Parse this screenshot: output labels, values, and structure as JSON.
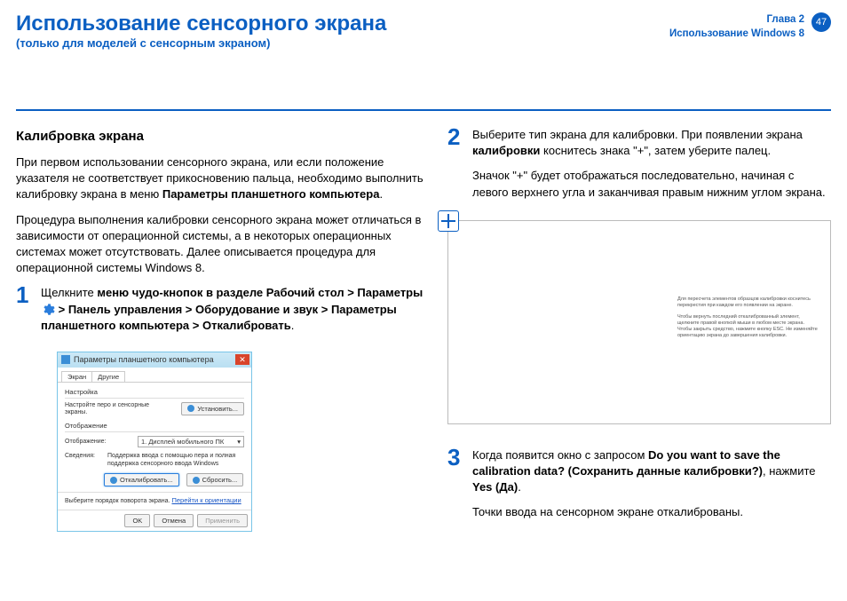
{
  "header": {
    "title": "Использование сенсорного экрана",
    "subtitle": "(только для моделей с сенсорным экраном)",
    "chapter": "Глава 2",
    "chapter_sub": "Использование Windows 8",
    "page_num": "47"
  },
  "left": {
    "section_title": "Калибровка экрана",
    "p1a": "При первом использовании сенсорного экрана, или если положение указателя не соответствует прикосновению пальца, необходимо выполнить калибровку экрана в меню ",
    "p1b": "Параметры планшетного компьютера",
    "p1c": ".",
    "p2": "Процедура выполнения калибровки сенсорного экрана может отличаться в зависимости от операционной системы, а в некоторых операционных системах может отсутствовать. Далее описывается процедура для операционной системы Windows 8.",
    "step1": {
      "num": "1",
      "t1": "Щелкните ",
      "t2": "меню чудо-кнопок в разделе Рабочий стол > Параметры ",
      "t3": " > Панель управления > Оборудование и звук > Параметры планшетного компьютера > Откалибровать",
      "t4": "."
    }
  },
  "dialog": {
    "title": "Параметры планшетного компьютера",
    "tab1": "Экран",
    "tab2": "Другие",
    "group1_label": "Настройка",
    "group1_text": "Настройте перо и сенсорные экраны.",
    "btn_set": "Установить...",
    "group2_label": "Отображение",
    "display_label": "Отображение:",
    "display_value": "1. Дисплей мобильного ПК",
    "detail_label": "Сведения:",
    "detail_text": "Поддержка ввода с помощью пера и полная поддержка сенсорного ввода Windows",
    "btn_calibrate": "Откалибровать...",
    "btn_reset": "Сбросить...",
    "footer_text": "Выберите порядок поворота экрана.",
    "footer_link": "Перейти к ориентации",
    "btn_ok": "OK",
    "btn_cancel": "Отмена",
    "btn_apply": "Применить"
  },
  "right": {
    "step2": {
      "num": "2",
      "p1a": "Выберите тип экрана для калибровки. При появлении экрана ",
      "p1b": "калибровки",
      "p1c": " коснитесь знака \"+\", затем уберите палец.",
      "p2": "Значок \"+\" будет отображаться последовательно, начиная с левого верхнего угла и заканчивая правым нижним углом экрана."
    },
    "calib_text1": "Для пересчета элементов образцов калибровки коснитесь перекрестия при каждом его появлении на экране.",
    "calib_text2": "Чтобы вернуть последний откалиброванный элемент, щелкните правой кнопкой мыши в любом месте экрана. Чтобы закрыть средство, нажмите кнопку ESC. Не изменяйте ориентацию экрана до завершения калибровки.",
    "step3": {
      "num": "3",
      "p1a": "Когда появится окно с запросом ",
      "p1b": "Do you want to save the calibration data? (Сохранить данные калибровки?)",
      "p1c": ", нажмите ",
      "p1d": "Yes (Да)",
      "p1e": ".",
      "p2": "Точки ввода на сенсорном экране откалиброваны."
    }
  }
}
